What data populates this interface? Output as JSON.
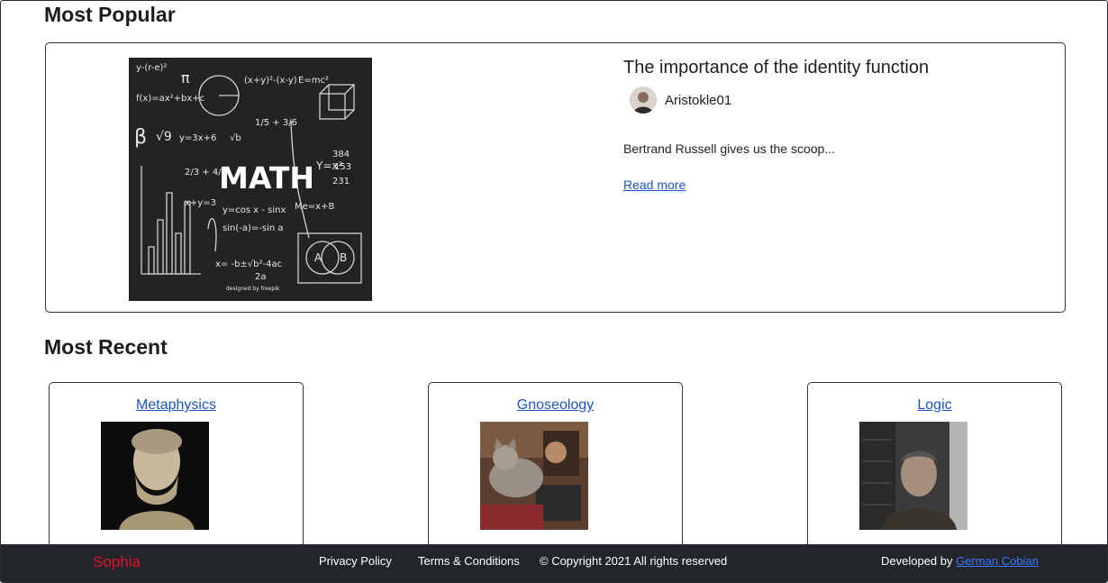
{
  "sections": {
    "popular_heading": "Most Popular",
    "recent_heading": "Most Recent"
  },
  "featured": {
    "image_icon": "math-chalkboard-image",
    "title": "The importance of the identity function",
    "author": "Aristokle01",
    "excerpt": "Bertrand Russell gives us the scoop...",
    "read_more": "Read more"
  },
  "recent": [
    {
      "title": "Metaphysics",
      "image_icon": "aristotle-bust-image"
    },
    {
      "title": "Gnoseology",
      "image_icon": "cat-and-man-image"
    },
    {
      "title": "Logic",
      "image_icon": "man-portrait-image"
    }
  ],
  "footer": {
    "brand": "Sophia",
    "privacy": "Privacy Policy",
    "terms": "Terms & Conditions",
    "copyright": "© Copyright 2021 All rights reserved",
    "developed_by": "Developed by",
    "developer": "German Cobian"
  },
  "colors": {
    "link": "#1a55c8",
    "brand": "#e8102a",
    "footer_bg": "#22252a"
  }
}
